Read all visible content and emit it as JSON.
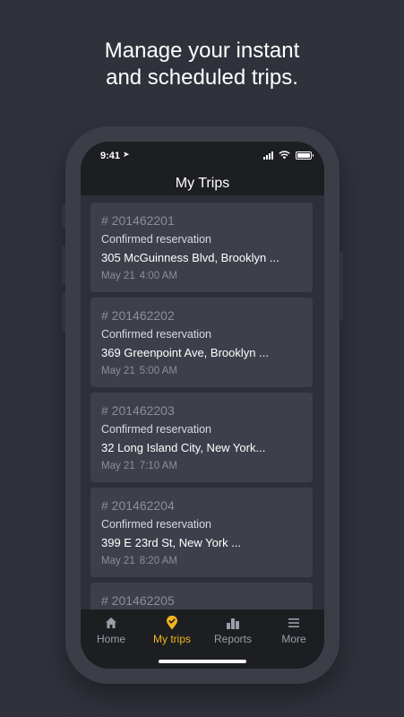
{
  "headline": {
    "line1": "Manage your instant",
    "line2": "and scheduled trips."
  },
  "status_bar": {
    "time": "9:41",
    "icons": [
      "location-arrow-icon",
      "signal-icon",
      "wifi-icon",
      "battery-icon"
    ]
  },
  "nav": {
    "title": "My Trips"
  },
  "trips": [
    {
      "id": "# 201462201",
      "status": "Confirmed reservation",
      "address": "305 McGuinness Blvd, Brooklyn ...",
      "date": "May 21",
      "time": "4:00 AM"
    },
    {
      "id": "# 201462202",
      "status": "Confirmed reservation",
      "address": "369 Greenpoint Ave, Brooklyn ...",
      "date": "May 21",
      "time": "5:00 AM"
    },
    {
      "id": "# 201462203",
      "status": "Confirmed reservation",
      "address": "32 Long Island City, New York...",
      "date": "May 21",
      "time": "7:10 AM"
    },
    {
      "id": "# 201462204",
      "status": "Confirmed reservation",
      "address": "399 E 23rd St, New York ...",
      "date": "May 21",
      "time": "8:20 AM"
    },
    {
      "id": "# 201462205",
      "status": "",
      "address": "",
      "date": "",
      "time": ""
    }
  ],
  "tabs": [
    {
      "label": "Home",
      "icon": "home-icon",
      "active": false
    },
    {
      "label": "My trips",
      "icon": "location-pin-check-icon",
      "active": true
    },
    {
      "label": "Reports",
      "icon": "bar-chart-icon",
      "active": false
    },
    {
      "label": "More",
      "icon": "menu-icon",
      "active": false
    }
  ],
  "colors": {
    "background": "#2f323b",
    "phone_frame": "#3b3e47",
    "screen": "#1c1e22",
    "card": "#3d404a",
    "accent": "#f2b51c",
    "muted_text": "#8a8e99"
  }
}
